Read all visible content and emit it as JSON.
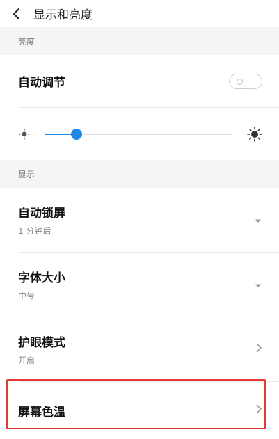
{
  "header": {
    "title": "显示和亮度",
    "back_icon": "chevron-left-icon"
  },
  "sections": {
    "brightness": {
      "label": "亮度"
    },
    "display": {
      "label": "显示"
    }
  },
  "auto_adjust": {
    "label": "自动调节",
    "enabled": false
  },
  "brightness_slider": {
    "value": 0.17,
    "min_icon": "sun-small-icon",
    "max_icon": "sun-large-icon",
    "accent": "#1e88e5"
  },
  "auto_lock": {
    "label": "自动锁屏",
    "value": "1 分钟后"
  },
  "font_size": {
    "label": "字体大小",
    "value": "中号"
  },
  "eye_care": {
    "label": "护眼模式",
    "value": "开启"
  },
  "color_temp": {
    "label": "屏幕色温"
  },
  "highlight_color": "#e53935"
}
